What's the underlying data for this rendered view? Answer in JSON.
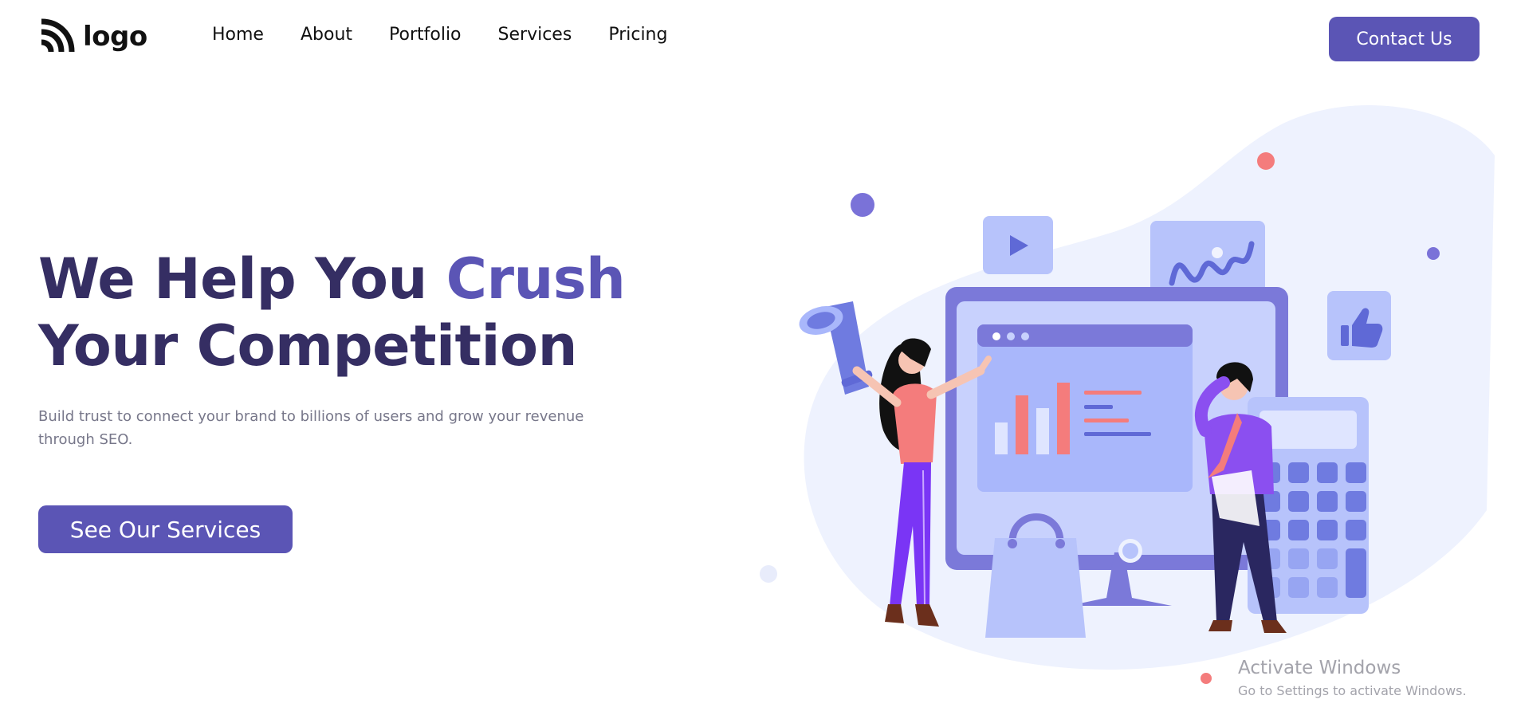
{
  "header": {
    "logo_text": "logo",
    "nav": [
      {
        "label": "Home"
      },
      {
        "label": "About"
      },
      {
        "label": "Portfolio"
      },
      {
        "label": "Services"
      },
      {
        "label": "Pricing"
      }
    ],
    "contact_label": "Contact Us"
  },
  "hero": {
    "title_part1": "We Help You ",
    "title_accent": "Crush",
    "title_part2": "Your Competition",
    "subtitle": "Build trust to connect your brand to billions of users and grow your revenue through SEO.",
    "cta_label": "See Our Services"
  },
  "illustration": {
    "icons": [
      "megaphone-icon",
      "play-icon",
      "wave-chart-icon",
      "thumbs-up-icon",
      "calculator-icon",
      "shopping-bag-icon",
      "monitor-icon"
    ]
  },
  "watermark": {
    "title": "Activate Windows",
    "subtitle": "Go to Settings to activate Windows."
  },
  "colors": {
    "primary": "#5b55b5",
    "heading": "#352e63",
    "body_text": "#77778a",
    "accent_red": "#f47c7c",
    "blob": "#eef2fe"
  }
}
